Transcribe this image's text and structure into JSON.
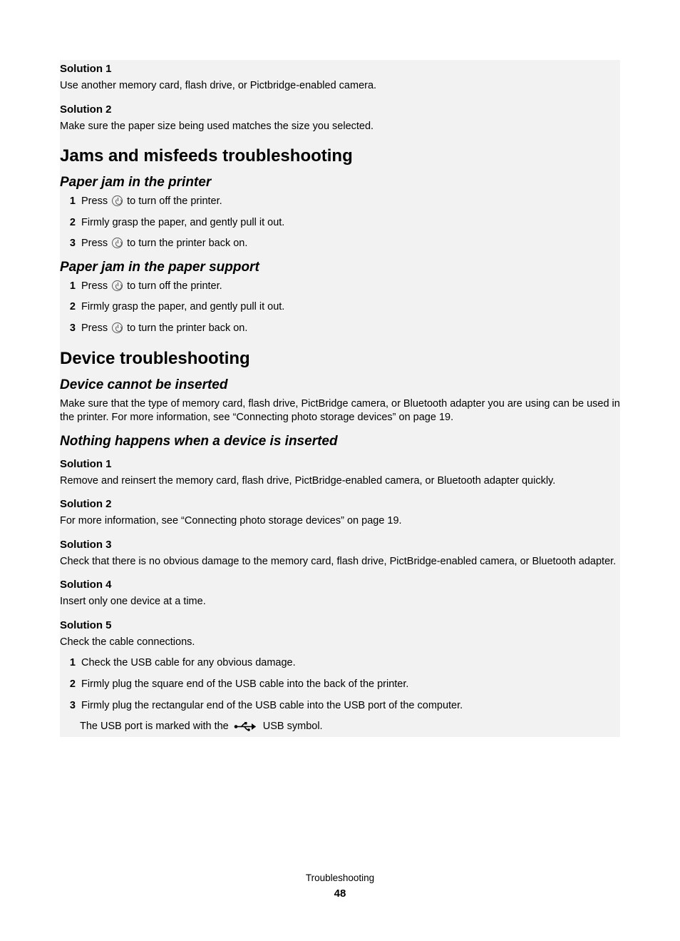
{
  "topSolutions": [
    {
      "title": "Solution 1",
      "text": "Use another memory card, flash drive, or Pictbridge-enabled camera."
    },
    {
      "title": "Solution 2",
      "text": "Make sure the paper size being used matches the size you selected."
    }
  ],
  "jamsHeading": "Jams and misfeeds troubleshooting",
  "jamPrinter": {
    "title": "Paper jam in the printer",
    "steps": {
      "s1a": "Press ",
      "s1b": " to turn off the printer.",
      "s2": "Firmly grasp the paper, and gently pull it out.",
      "s3a": "Press ",
      "s3b": " to turn the printer back on."
    }
  },
  "jamSupport": {
    "title": "Paper jam in the paper support",
    "steps": {
      "s1a": "Press ",
      "s1b": " to turn off the printer.",
      "s2": "Firmly grasp the paper, and gently pull it out.",
      "s3a": "Press ",
      "s3b": " to turn the printer back on."
    }
  },
  "deviceHeading": "Device troubleshooting",
  "deviceCannot": {
    "title": "Device cannot be inserted",
    "text": "Make sure that the type of memory card, flash drive, PictBridge camera, or Bluetooth adapter you are using can be used in the printer. For more information, see “Connecting photo storage devices” on page 19."
  },
  "nothingHappens": {
    "title": "Nothing happens when a device is inserted",
    "solutions": [
      {
        "title": "Solution 1",
        "text": "Remove and reinsert the memory card, flash drive, PictBridge-enabled camera, or Bluetooth adapter quickly."
      },
      {
        "title": "Solution 2",
        "text": "For more information, see “Connecting photo storage devices” on page 19."
      },
      {
        "title": "Solution 3",
        "text": "Check that there is no obvious damage to the memory card, flash drive, PictBridge-enabled camera, or Bluetooth adapter."
      },
      {
        "title": "Solution 4",
        "text": "Insert only one device at a time."
      }
    ],
    "sol5": {
      "title": "Solution 5",
      "text": "Check the cable connections.",
      "steps": {
        "s1": "Check the USB cable for any obvious damage.",
        "s2": "Firmly plug the square end of the USB cable into the back of the printer.",
        "s3": "Firmly plug the rectangular end of the USB cable into the USB port of the computer.",
        "noteA": "The USB port is marked with the ",
        "noteB": " USB symbol."
      }
    }
  },
  "footer": {
    "section": "Troubleshooting",
    "page": "48"
  },
  "nums": {
    "n1": "1",
    "n2": "2",
    "n3": "3"
  }
}
